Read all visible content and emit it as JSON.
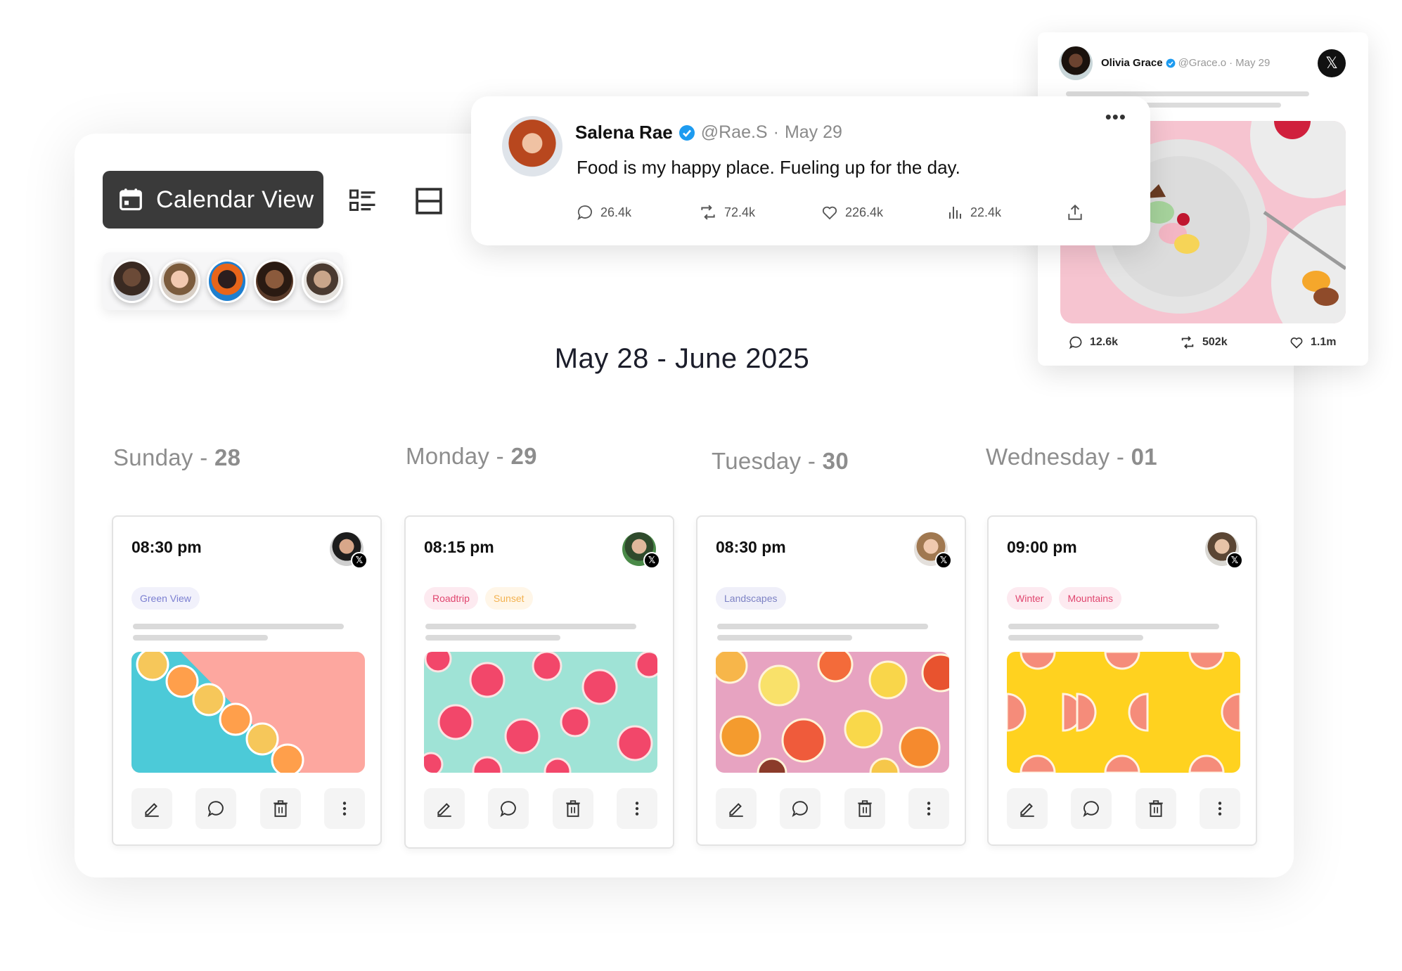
{
  "toolbar": {
    "calendar_view_label": "Calendar View",
    "icons": [
      "calendar-icon",
      "list-view-icon",
      "split-view-icon"
    ]
  },
  "team": {
    "avatars": [
      "avatar-1",
      "avatar-2",
      "avatar-3",
      "avatar-4",
      "avatar-5"
    ]
  },
  "date_range": "May 28 - June 2025",
  "days": [
    {
      "label": "Sunday - ",
      "num": "28",
      "time": "08:30 pm",
      "tags": [
        {
          "text": "Green View",
          "style": "green"
        }
      ],
      "image": "citrus-diagonal-teal-pink"
    },
    {
      "label": "Monday - ",
      "num": "29",
      "time": "08:15 pm",
      "tags": [
        {
          "text": "Roadtrip",
          "style": "pink"
        },
        {
          "text": "Sunset",
          "style": "orange"
        }
      ],
      "image": "grapefruit-on-mint"
    },
    {
      "label": "Tuesday - ",
      "num": "30",
      "time": "08:30 pm",
      "tags": [
        {
          "text": "Landscapes",
          "style": "lav"
        }
      ],
      "image": "mixed-citrus-on-pink"
    },
    {
      "label": "Wednesday - ",
      "num": "01",
      "time": "09:00 pm",
      "tags": [
        {
          "text": "Winter",
          "style": "pink"
        },
        {
          "text": "Mountains",
          "style": "pink"
        }
      ],
      "image": "grapefruit-on-yellow"
    }
  ],
  "card_actions": [
    "edit-icon",
    "comment-icon",
    "delete-icon",
    "more-icon"
  ],
  "tweet_main": {
    "name": "Salena Rae",
    "handle": "@Rae.S",
    "dot": "·",
    "date": "May 29",
    "text": "Food is my happy place. Fueling up for the day.",
    "more": "•••",
    "stats": {
      "replies": "26.4k",
      "retweets": "72.4k",
      "likes": "226.4k",
      "views": "22.4k"
    }
  },
  "tweet_side": {
    "name": "Olivia Grace",
    "handle": "@Grace.o",
    "dot": "·",
    "date": "May 29",
    "x_logo": "𝕏",
    "stats": {
      "replies": "12.6k",
      "retweets": "502k",
      "likes": "1.1m"
    }
  },
  "colors": {
    "dark_button": "#3a3a3a",
    "verified": "#1d9bf0",
    "tag_pink": "#e0466f",
    "tag_lavender": "#7b7fd1"
  }
}
